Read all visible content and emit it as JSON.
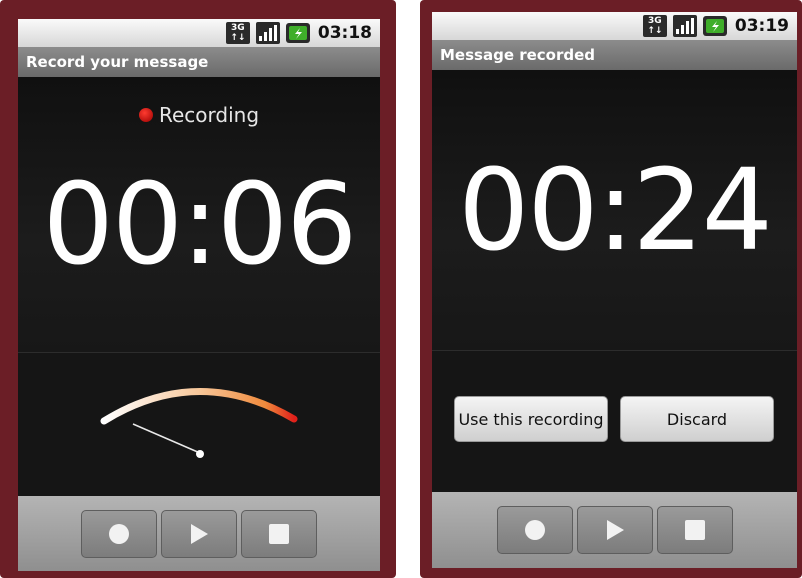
{
  "left": {
    "status_time": "03:18",
    "network_label": "3G",
    "title": "Record your message",
    "recording_label": "Recording",
    "timer": "00:06",
    "controls": [
      "record",
      "play",
      "stop"
    ]
  },
  "right": {
    "status_time": "03:19",
    "network_label": "3G",
    "title": "Message recorded",
    "timer": "00:24",
    "use_button": "Use this recording",
    "discard_button": "Discard",
    "controls": [
      "record",
      "play",
      "stop"
    ]
  },
  "colors": {
    "frame": "#6b1e26",
    "record_dot": "#d10000",
    "battery": "#3fae2a"
  }
}
